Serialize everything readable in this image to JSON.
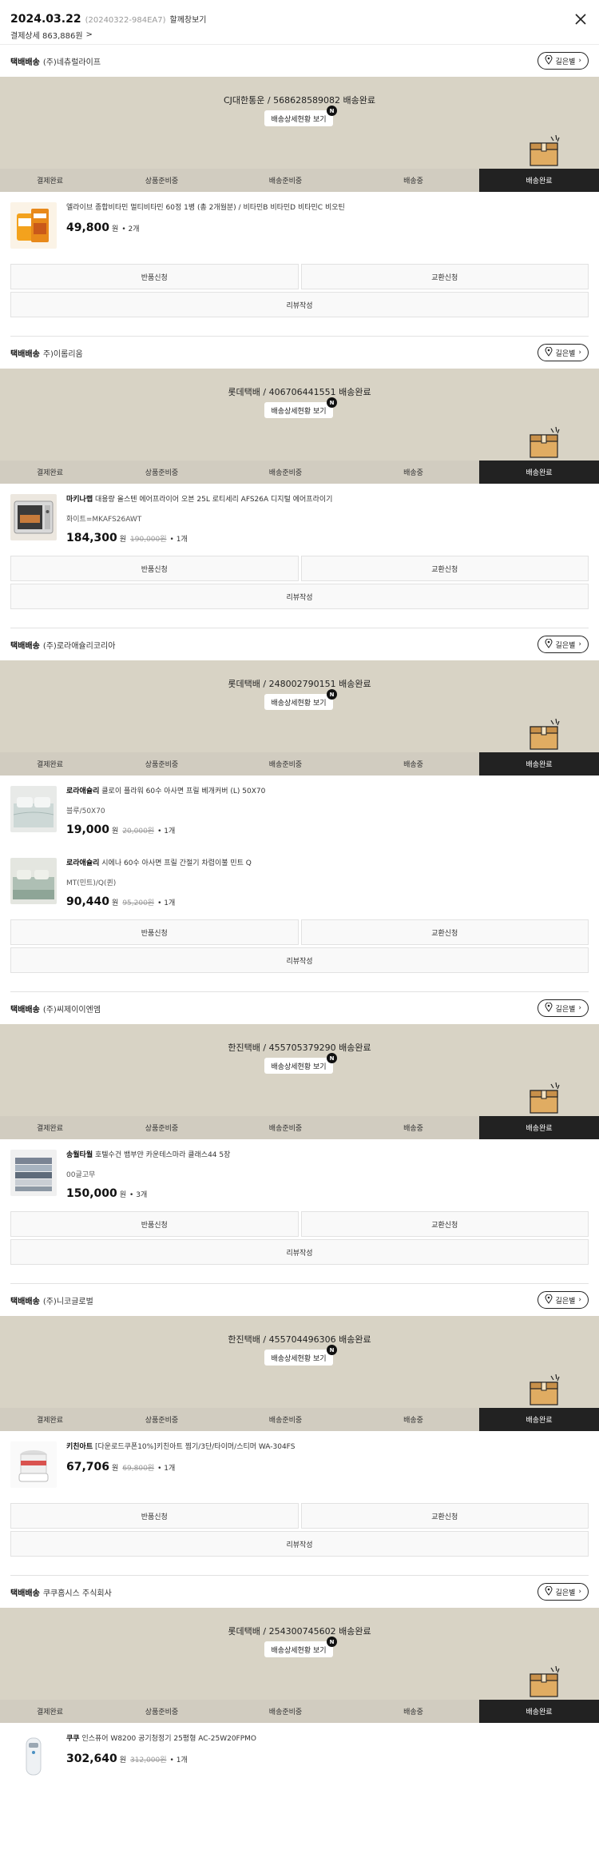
{
  "header": {
    "order_date": "2024.03.22",
    "order_no": "(20240322-984EA7)",
    "open_window": "할께창보기",
    "pay_detail": "결제상세 863,886원",
    "pay_chev": ">"
  },
  "labels": {
    "map_btn": "길은별",
    "detail_btn": "배송상세현황 보기",
    "new_badge": "N",
    "steps": [
      "결제완료",
      "상품준비중",
      "배송준비중",
      "배송중",
      "배송완료"
    ],
    "return_btn": "반품신청",
    "exchange_btn": "교환신청",
    "review_btn": "리뷰작성",
    "won": "원",
    "ship_type": "택배배송"
  },
  "shipments": [
    {
      "seller": "(주)네츄럴라이프",
      "carrier": "CJ대한통운 / 568628589082 배송완료",
      "items": [
        {
          "brand": "",
          "name": "엘라이브 종합비타민 멀티비타민 60정 1병 (총 2개월분) / 비타민B 비타민D 비타민C 비오틴",
          "option": "",
          "price": "49,800",
          "orig": "",
          "qty": "• 2개",
          "thumb": "vitamin"
        }
      ]
    },
    {
      "seller": "주)이롬리움",
      "carrier": "롯데택배 / 406706441551 배송완료",
      "items": [
        {
          "brand": "마키나랩",
          "name": "대용량 올스텐 에어프라이어 오븐 25L 로티세리 AFS26A 디지털 에어프라이기",
          "option": "화이트=MKAFS26AWT",
          "price": "184,300",
          "orig": "190,000원",
          "qty": "• 1개",
          "thumb": "oven"
        }
      ]
    },
    {
      "seller": "(주)로라애슐리코리아",
      "carrier": "롯데택배 / 248002790151 배송완료",
      "items": [
        {
          "brand": "로라애슐리",
          "name": "클로이 플라워 60수 아사면 프릴 베개커버 (L) 50X70",
          "option": "블루/50X70",
          "price": "19,000",
          "orig": "20,000원",
          "qty": "• 1개",
          "thumb": "bed1"
        },
        {
          "brand": "로라애슐리",
          "name": "시에나 60수 아사면 프릴 간절기 차렵이불 민트 Q",
          "option": "MT(민트)/Q(퀸)",
          "price": "90,440",
          "orig": "95,200원",
          "qty": "• 1개",
          "thumb": "bed2"
        }
      ]
    },
    {
      "seller": "(주)씨제이이엔엠",
      "carrier": "한진택배 / 455705379290 배송완료",
      "items": [
        {
          "brand": "송월타월",
          "name": "호텔수건 뱀부얀 카운테스마라 클래스44 5장",
          "option": "00글고무",
          "price": "150,000",
          "orig": "",
          "qty": "• 3개",
          "thumb": "towel"
        }
      ]
    },
    {
      "seller": "(주)니코글로벌",
      "carrier": "한진택배 / 455704496306 배송완료",
      "items": [
        {
          "brand": "키친아트",
          "name": "[다운로드쿠폰10%]키친아트 찜기/3단/타이머/스티머 WA-304FS",
          "option": "",
          "price": "67,706",
          "orig": "69,800원",
          "qty": "• 1개",
          "thumb": "steamer"
        }
      ]
    },
    {
      "seller": "쿠쿠홈시스 주식회사",
      "carrier": "롯데택배 / 254300745602 배송완료",
      "items": [
        {
          "brand": "쿠쿠",
          "name": "인스퓨어 W8200 공기청정기 25평형 AC-25W20FPMO",
          "option": "",
          "price": "302,640",
          "orig": "312,000원",
          "qty": "• 1개",
          "thumb": "purifier"
        }
      ]
    }
  ]
}
